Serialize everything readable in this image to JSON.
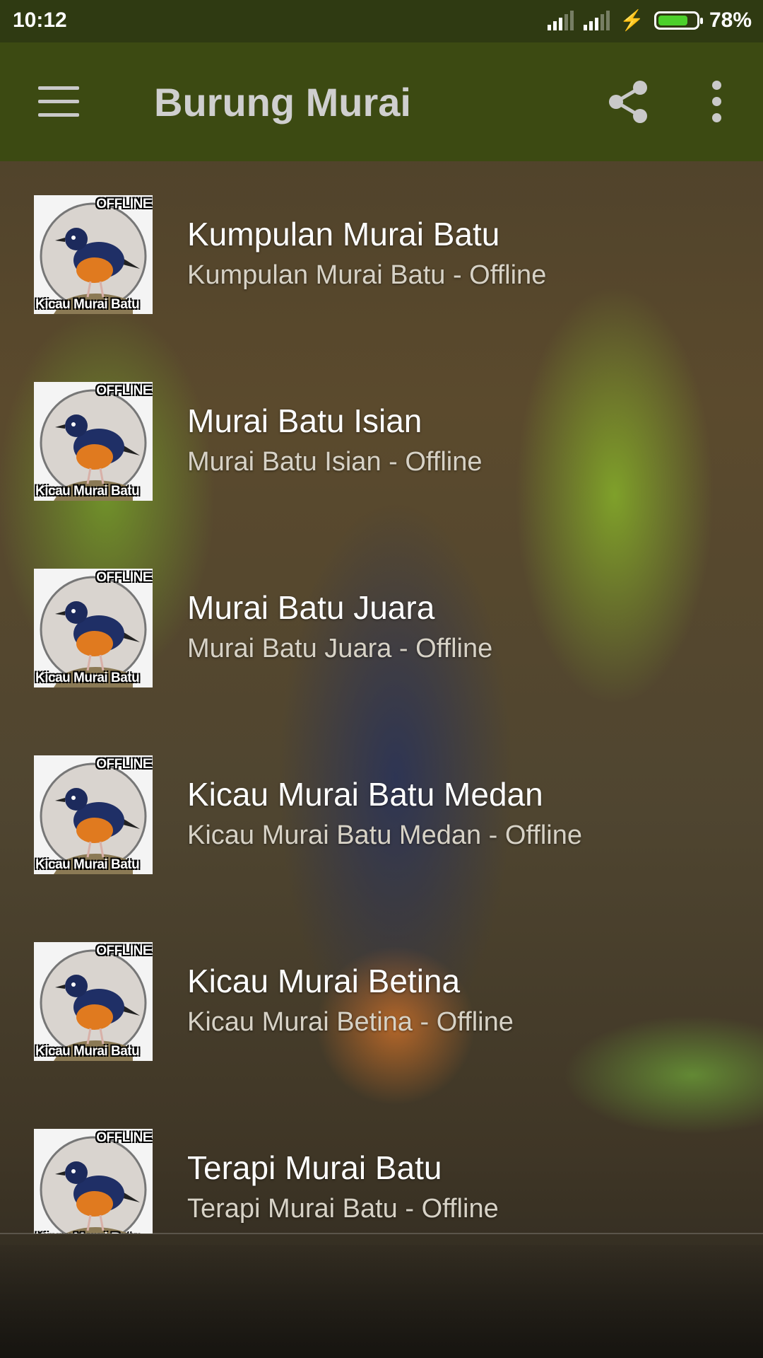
{
  "status_bar": {
    "time": "10:12",
    "battery_percent": "78%",
    "battery_level": 0.78,
    "icons": [
      "signal-icon",
      "signal-icon",
      "charging-icon",
      "battery-icon"
    ]
  },
  "app_bar": {
    "title": "Burung Murai",
    "menu_icon": "hamburger-menu-icon",
    "share_icon": "share-icon",
    "more_icon": "more-vert-icon",
    "color": "#3c4a12"
  },
  "thumbnail": {
    "badge_top": "OFFLINE",
    "badge_bottom": "Kicau Murai Batu"
  },
  "items": [
    {
      "title": "Kumpulan Murai Batu",
      "subtitle": "Kumpulan Murai Batu - Offline"
    },
    {
      "title": "Murai Batu Isian",
      "subtitle": "Murai Batu Isian - Offline"
    },
    {
      "title": "Murai Batu Juara",
      "subtitle": "Murai Batu Juara - Offline"
    },
    {
      "title": "Kicau Murai Batu Medan",
      "subtitle": "Kicau Murai Batu Medan - Offline"
    },
    {
      "title": "Kicau Murai Betina",
      "subtitle": "Kicau Murai Betina - Offline"
    },
    {
      "title": "Terapi Murai Batu",
      "subtitle": "Terapi Murai Batu - Offline"
    }
  ]
}
